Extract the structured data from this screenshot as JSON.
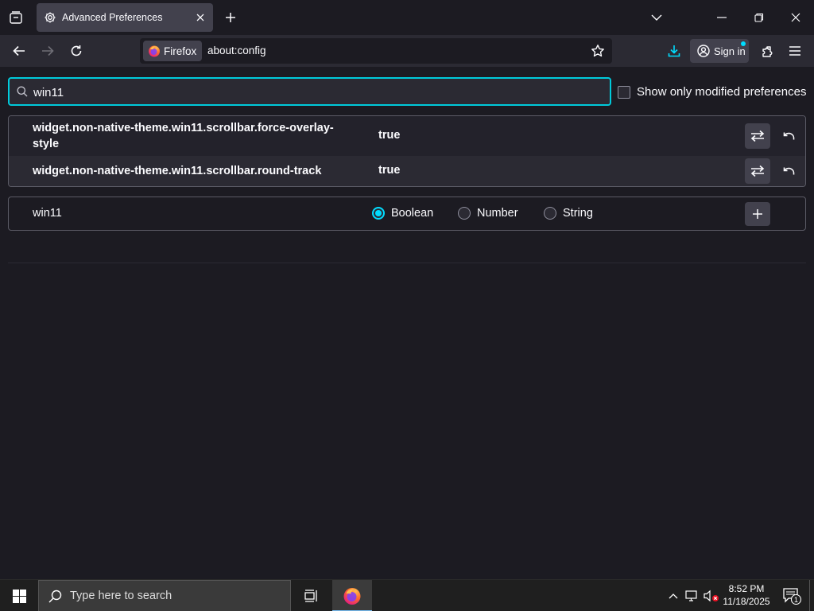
{
  "browser": {
    "tab": {
      "title": "Advanced Preferences"
    },
    "urlbar": {
      "identity": "Firefox",
      "url": "about:config"
    },
    "signin_label": "Sign in"
  },
  "config": {
    "search": {
      "value": "win11"
    },
    "modified_only_label": "Show only modified preferences",
    "modified_only_checked": false,
    "prefs": [
      {
        "name": "widget.non-native-theme.win11.scrollbar.force-overlay-style",
        "value": "true"
      },
      {
        "name": "widget.non-native-theme.win11.scrollbar.round-track",
        "value": "true"
      }
    ],
    "new_pref": {
      "name": "win11",
      "types": [
        "Boolean",
        "Number",
        "String"
      ],
      "selected": "Boolean"
    }
  },
  "taskbar": {
    "search_placeholder": "Type here to search",
    "time": "8:52 PM",
    "date": "11/18/2025",
    "notification_count": "1"
  },
  "icons": {
    "tab_list": "tab-list-icon",
    "settings": "gear-icon",
    "close": "close-icon",
    "new_tab": "plus-icon",
    "back": "arrow-left-icon",
    "forward": "arrow-right-icon",
    "reload": "reload-icon",
    "bookmark": "star-icon",
    "download": "download-icon",
    "account": "account-icon",
    "extensions": "puzzle-icon",
    "menu": "hamburger-icon",
    "search": "magnifier-icon",
    "toggle": "swap-arrows-icon",
    "reset": "undo-icon",
    "add": "plus-icon"
  },
  "colors": {
    "accent": "#00ddff",
    "focus_border": "#00cadb",
    "background": "#1c1b22",
    "toolbar": "#2b2a33",
    "button": "#42414d"
  }
}
